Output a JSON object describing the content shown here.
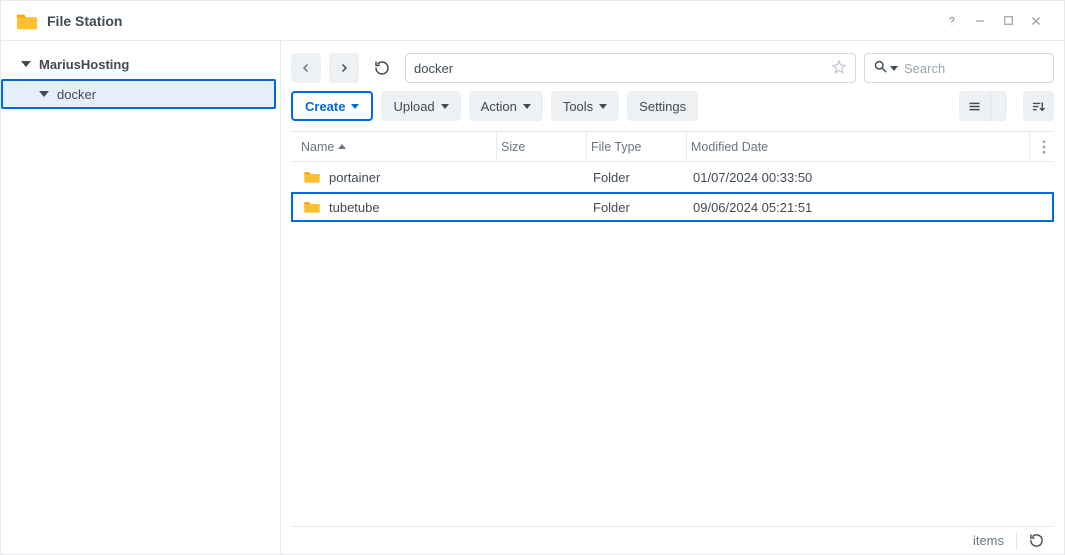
{
  "window": {
    "title": "File Station"
  },
  "tree": {
    "root": {
      "label": "MariusHosting",
      "expanded": true
    },
    "children": [
      {
        "label": "docker",
        "selected": true,
        "expanded": true
      }
    ]
  },
  "toolbar": {
    "path": "docker",
    "search_placeholder": "Search",
    "create_label": "Create",
    "upload_label": "Upload",
    "action_label": "Action",
    "tools_label": "Tools",
    "settings_label": "Settings"
  },
  "columns": {
    "name": "Name",
    "size": "Size",
    "filetype": "File Type",
    "modified": "Modified Date"
  },
  "rows": [
    {
      "name": "portainer",
      "size": "",
      "filetype": "Folder",
      "modified": "01/07/2024 00:33:50",
      "selected": false
    },
    {
      "name": "tubetube",
      "size": "",
      "filetype": "Folder",
      "modified": "09/06/2024 05:21:51",
      "selected": true
    }
  ],
  "status": {
    "items_label": "items"
  }
}
